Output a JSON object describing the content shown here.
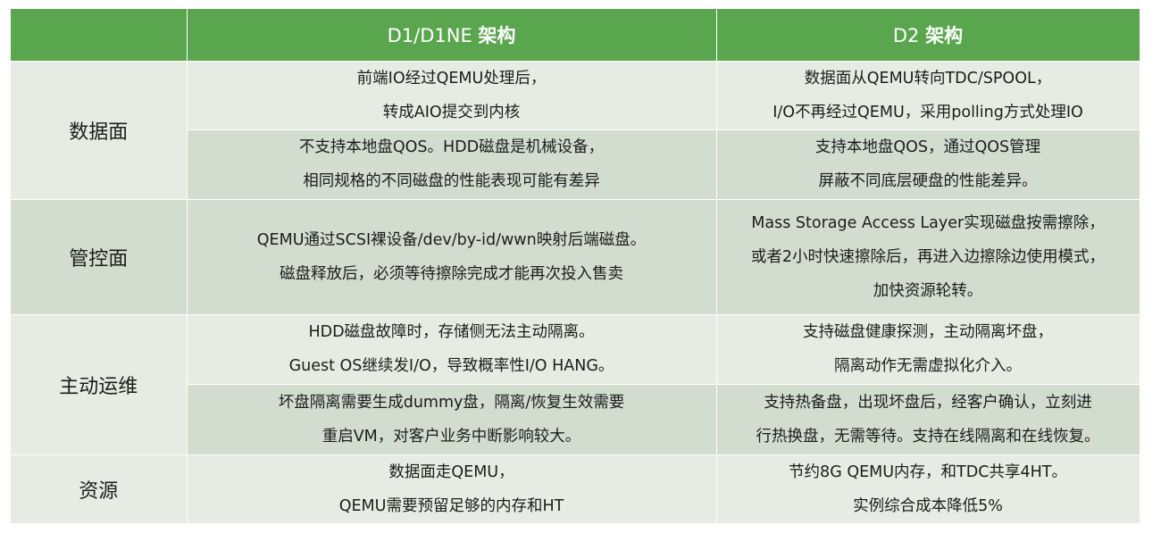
{
  "header": {
    "col_d1_name": "D1/D1NE ",
    "col_d1_bold": "架构",
    "col_d2_name": "D2 ",
    "col_d2_bold": "架构"
  },
  "rows": {
    "data_plane": {
      "label": "数据面",
      "sub1": {
        "d1": [
          "前端IO经过QEMU处理后，",
          "转成AIO提交到内核"
        ],
        "d2": [
          "数据面从QEMU转向TDC/SPOOL，",
          "I/O不再经过QEMU，采用polling方式处理IO"
        ]
      },
      "sub2": {
        "d1": [
          "不支持本地盘QOS。HDD磁盘是机械设备，",
          "相同规格的不同磁盘的性能表现可能有差异"
        ],
        "d2": [
          "支持本地盘QOS，通过QOS管理",
          "屏蔽不同底层硬盘的性能差异。"
        ]
      }
    },
    "control_plane": {
      "label": "管控面",
      "d1": [
        "QEMU通过SCSI裸设备/dev/by-id/wwn映射后端磁盘。",
        "磁盘释放后，必须等待擦除完成才能再次投入售卖"
      ],
      "d2": [
        "Mass Storage Access Layer实现磁盘按需擦除，",
        "或者2小时快速擦除后，再进入边擦除边使用模式，",
        "加快资源轮转。"
      ]
    },
    "active_ops": {
      "label": "主动运维",
      "sub1": {
        "d1": [
          "HDD磁盘故障时，存储侧无法主动隔离。",
          "Guest OS继续发I/O，导致概率性I/O HANG。"
        ],
        "d2": [
          "支持磁盘健康探测，主动隔离坏盘，",
          "隔离动作无需虚拟化介入。"
        ]
      },
      "sub2": {
        "d1": [
          "坏盘隔离需要生成dummy盘，隔离/恢复生效需要",
          "重启VM，对客户业务中断影响较大。"
        ],
        "d2": [
          "支持热备盘，出现坏盘后，经客户确认，立刻进",
          "行热换盘，无需等待。支持在线隔离和在线恢复。"
        ]
      }
    },
    "resources": {
      "label": "资源",
      "d1": [
        "数据面走QEMU，",
        "QEMU需要预留足够的内存和HT"
      ],
      "d2": [
        "节约8G QEMU内存，和TDC共享4HT。",
        "实例综合成本降低5%"
      ]
    }
  },
  "colors": {
    "header_bg": "#5aa64e",
    "row_light": "#e6ece4",
    "row_dark": "#d2dccf"
  }
}
